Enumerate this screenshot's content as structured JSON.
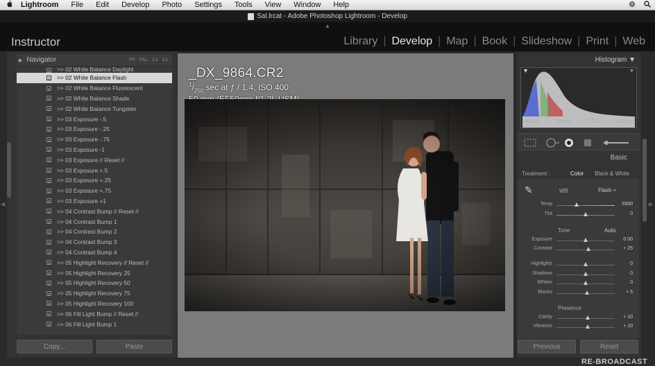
{
  "menubar": {
    "apple": "",
    "items": [
      "Lightroom",
      "File",
      "Edit",
      "Develop",
      "Photo",
      "Settings",
      "Tools",
      "View",
      "Window",
      "Help"
    ],
    "right_icons": [
      "gear-icon",
      "search-icon"
    ]
  },
  "window": {
    "title": "Sal.lrcat - Adobe Photoshop Lightroom - Develop"
  },
  "identity_plate": "Instructor",
  "modules": [
    "Library",
    "Develop",
    "Map",
    "Book",
    "Slideshow",
    "Print",
    "Web"
  ],
  "active_module": "Develop",
  "navigator": {
    "label": "Navigator",
    "zoom_options": [
      "FIT",
      "FILL",
      "1:1",
      "3:1"
    ]
  },
  "presets": [
    ">> 02 White Balance Daylight",
    ">> 02 White Balance Flash",
    ">> 02 White Balance Fluorescent",
    ">> 02 White Balance Shade",
    ">> 02 White Balance Tungsten",
    ">> 03 Exposure -.5",
    ">> 03 Exposure -.25",
    ">> 03 Exposure -.75",
    ">> 03 Exposure -1",
    ">> 03 Exposure // Reset //",
    ">> 03 Exposure +.5",
    ">> 03 Exposure +.25",
    ">> 03 Exposure +.75",
    ">> 03 Exposure +1",
    ">> 04 Contrast Bump // Reset //",
    ">> 04 Contrast Bump 1",
    ">> 04 Contrast Bump 2",
    ">> 04 Contrast Bump 3",
    ">> 04 Contrast Bump 4",
    ">> 05 Highlight Recovery // Reset //",
    ">> 05 Highlight Recovery 25",
    ">> 05 Highlight Recovery 50",
    ">> 05 Highlight Recovery 75",
    ">> 05 Highlight Recovery 100",
    ">> 06 Fill Light Bump // Reset //",
    ">> 06 Fill Light Bump 1"
  ],
  "selected_preset_index": 1,
  "left_buttons": {
    "copy": "Copy...",
    "paste": "Paste"
  },
  "photo_info": {
    "filename": "_DX_9864.CR2",
    "shutter_num": "1",
    "shutter_den": "250",
    "exposure_rest": " sec at ƒ / 1.4, ISO 400",
    "lens": "50 mm (EF50mm f/1.2L USM)"
  },
  "histogram": {
    "label": "Histogram",
    "readouts": [
      "ISO 400",
      "50 mm",
      "f / 1.4",
      "1/250 sec"
    ]
  },
  "basic": {
    "label": "Basic",
    "treatment_label": "Treatment :",
    "treatment_options": [
      "Color",
      "Black & White"
    ],
    "treatment_selected": "Color",
    "wb_label": "WB :",
    "wb_value": "Flash ÷",
    "tone_label": "Tone",
    "auto_label": "Auto",
    "presence_label": "Presence",
    "sliders": [
      {
        "label": "Temp",
        "value": "5500",
        "pos": 0.35
      },
      {
        "label": "Tint",
        "value": "0",
        "pos": 0.5
      },
      {
        "label": "Exposure",
        "value": "0.00",
        "pos": 0.5
      },
      {
        "label": "Contrast",
        "value": "+ 25",
        "pos": 0.55
      },
      {
        "label": "Highlights",
        "value": "0",
        "pos": 0.5
      },
      {
        "label": "Shadows",
        "value": "0",
        "pos": 0.5
      },
      {
        "label": "Whites",
        "value": "0",
        "pos": 0.5
      },
      {
        "label": "Blacks",
        "value": "+ 5",
        "pos": 0.52
      },
      {
        "label": "Clarity",
        "value": "+ 10",
        "pos": 0.53
      },
      {
        "label": "Vibrance",
        "value": "+ 10",
        "pos": 0.53
      }
    ]
  },
  "right_buttons": {
    "previous": "Previous",
    "reset": "Reset"
  },
  "watermark": "RE-BROADCAST",
  "colors": {
    "active_module": "#e8e8e8",
    "selected_row": "#d8d8d8"
  }
}
